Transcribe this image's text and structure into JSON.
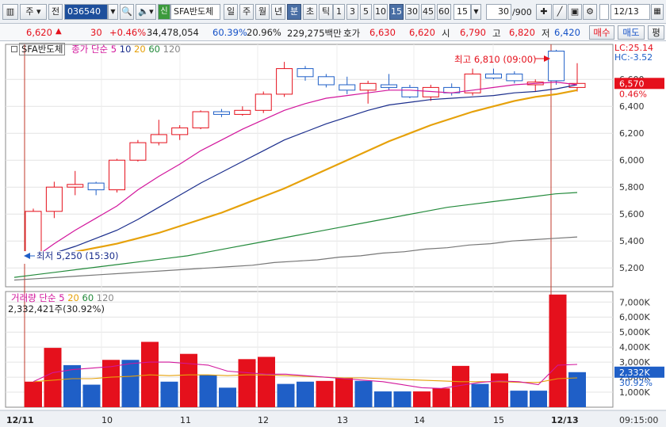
{
  "toolbar": {
    "type_label": "주",
    "market_label": "전",
    "code": "036540",
    "credit_badge": "신",
    "stock_name": "SFA반도체",
    "periods": [
      "일",
      "주",
      "월",
      "년",
      "분",
      "초",
      "틱"
    ],
    "active_period": "분",
    "intervals": [
      "1",
      "3",
      "5",
      "10",
      "15",
      "30",
      "45",
      "60"
    ],
    "active_interval": "15",
    "interval_select": "15",
    "count": "30",
    "count_max": "/900",
    "date": "12/13"
  },
  "quote": {
    "price": "6,620",
    "arrow": "▲",
    "change": "30",
    "change_pct": "+0.46%",
    "volume": "34,478,054",
    "vol_ratio": "60.39%",
    "turnover": "20.96%",
    "amount": "229,275백만",
    "hoga_label": "호가",
    "hoga_sell": "6,630",
    "hoga_buy": "6,620",
    "open_label": "시",
    "open": "6,790",
    "high_label": "고",
    "high": "6,820",
    "low_label": "저",
    "low": "6,420",
    "buy_btn": "매수",
    "sell_btn": "매도",
    "more_btn": "평"
  },
  "price_panel": {
    "name": "SFA반도체",
    "legend_prefix": "종가 단순",
    "ma_labels": [
      "5",
      "10",
      "20",
      "60",
      "120"
    ],
    "max_annotation": "최고 6,810 (09:00)",
    "min_annotation": "최저 5,250 (15:30)",
    "lc": "LC:25.14",
    "hc": "HC:-3.52",
    "current_price_tag": "6,570",
    "current_pct_tag": "0.46%"
  },
  "volume_panel": {
    "legend_prefix": "거래량 단순",
    "ma_labels": [
      "5",
      "20",
      "60",
      "120"
    ],
    "summary": "2,332,421주(30.92%)",
    "current_tag": "2,332K",
    "current_pct_tag": "30.92%"
  },
  "x_labels": [
    "12/11",
    "10",
    "11",
    "12",
    "13",
    "14",
    "15",
    "12/13"
  ],
  "time_label": "09:15:00",
  "colors": {
    "up": "#e5101c",
    "down": "#1f5fc7",
    "ma5": "#d2169c",
    "ma10": "#1a2d8c",
    "ma20": "#e6a10a",
    "ma60": "#238a3b",
    "ma120": "#777777"
  },
  "chart_data": {
    "type": "candlestick",
    "timeframe": "15min",
    "y_ticks": [
      5200,
      5400,
      5600,
      5800,
      6000,
      6200,
      6400,
      6600
    ],
    "candles": [
      {
        "o": 5260,
        "h": 5640,
        "l": 5250,
        "c": 5620
      },
      {
        "o": 5620,
        "h": 5840,
        "l": 5570,
        "c": 5800
      },
      {
        "o": 5800,
        "h": 5920,
        "l": 5740,
        "c": 5820
      },
      {
        "o": 5830,
        "h": 5840,
        "l": 5740,
        "c": 5780
      },
      {
        "o": 5780,
        "h": 6010,
        "l": 5760,
        "c": 6000
      },
      {
        "o": 6000,
        "h": 6150,
        "l": 5990,
        "c": 6130
      },
      {
        "o": 6130,
        "h": 6300,
        "l": 6110,
        "c": 6190
      },
      {
        "o": 6190,
        "h": 6260,
        "l": 6150,
        "c": 6240
      },
      {
        "o": 6240,
        "h": 6370,
        "l": 6230,
        "c": 6360
      },
      {
        "o": 6360,
        "h": 6380,
        "l": 6320,
        "c": 6340
      },
      {
        "o": 6340,
        "h": 6400,
        "l": 6330,
        "c": 6370
      },
      {
        "o": 6370,
        "h": 6510,
        "l": 6350,
        "c": 6490
      },
      {
        "o": 6490,
        "h": 6730,
        "l": 6470,
        "c": 6680
      },
      {
        "o": 6680,
        "h": 6700,
        "l": 6590,
        "c": 6620
      },
      {
        "o": 6620,
        "h": 6640,
        "l": 6540,
        "c": 6560
      },
      {
        "o": 6560,
        "h": 6620,
        "l": 6490,
        "c": 6520
      },
      {
        "o": 6520,
        "h": 6590,
        "l": 6420,
        "c": 6570
      },
      {
        "o": 6560,
        "h": 6640,
        "l": 6520,
        "c": 6540
      },
      {
        "o": 6540,
        "h": 6560,
        "l": 6460,
        "c": 6470
      },
      {
        "o": 6470,
        "h": 6560,
        "l": 6440,
        "c": 6540
      },
      {
        "o": 6540,
        "h": 6570,
        "l": 6480,
        "c": 6500
      },
      {
        "o": 6500,
        "h": 6680,
        "l": 6480,
        "c": 6640
      },
      {
        "o": 6640,
        "h": 6680,
        "l": 6600,
        "c": 6610
      },
      {
        "o": 6640,
        "h": 6660,
        "l": 6570,
        "c": 6590
      },
      {
        "o": 6560,
        "h": 6600,
        "l": 6510,
        "c": 6580
      },
      {
        "o": 6810,
        "h": 6820,
        "l": 6560,
        "c": 6590
      },
      {
        "o": 6540,
        "h": 6720,
        "l": 6510,
        "c": 6570
      }
    ],
    "ma": {
      "ma5": [
        5270,
        5380,
        5480,
        5570,
        5660,
        5780,
        5880,
        5970,
        6070,
        6150,
        6230,
        6300,
        6370,
        6420,
        6460,
        6480,
        6500,
        6520,
        6520,
        6510,
        6500,
        6520,
        6540,
        6560,
        6570,
        6580,
        6560
      ],
      "ma10": [
        5270,
        5310,
        5360,
        5420,
        5480,
        5560,
        5650,
        5740,
        5830,
        5910,
        5990,
        6070,
        6150,
        6210,
        6270,
        6320,
        6370,
        6410,
        6430,
        6450,
        6460,
        6470,
        6480,
        6500,
        6510,
        6530,
        6560
      ],
      "ma20": [
        5260,
        5290,
        5320,
        5350,
        5380,
        5420,
        5460,
        5510,
        5560,
        5610,
        5670,
        5730,
        5790,
        5860,
        5930,
        6000,
        6070,
        6140,
        6200,
        6260,
        6310,
        6360,
        6400,
        6440,
        6470,
        6490,
        6520
      ],
      "ma60": [
        5130,
        5150,
        5170,
        5190,
        5210,
        5230,
        5250,
        5270,
        5290,
        5320,
        5350,
        5380,
        5410,
        5440,
        5470,
        5500,
        5530,
        5560,
        5590,
        5620,
        5650,
        5670,
        5690,
        5710,
        5730,
        5750,
        5760
      ],
      "ma120": [
        5110,
        5120,
        5130,
        5140,
        5150,
        5160,
        5170,
        5180,
        5190,
        5200,
        5210,
        5220,
        5240,
        5250,
        5260,
        5280,
        5290,
        5310,
        5320,
        5340,
        5350,
        5370,
        5380,
        5400,
        5410,
        5420,
        5430
      ]
    },
    "volume_ticks": [
      "1,000K",
      "2,000K",
      "3,000K",
      "4,000K",
      "5,000K",
      "6,000K",
      "7,000K"
    ],
    "volume": [
      1700,
      3950,
      2800,
      1500,
      3150,
      3150,
      4350,
      1700,
      3550,
      2150,
      1300,
      3200,
      3350,
      1550,
      1700,
      1750,
      1950,
      1750,
      1050,
      1050,
      1050,
      1250,
      2750,
      1550,
      2250,
      1100,
      1100,
      7500,
      2332
    ],
    "volume_dir": [
      "up",
      "up",
      "down",
      "down",
      "up",
      "down",
      "up",
      "down",
      "up",
      "down",
      "down",
      "up",
      "up",
      "down",
      "down",
      "up",
      "up",
      "down",
      "down",
      "down",
      "up",
      "up",
      "up",
      "down",
      "up",
      "down",
      "down",
      "up",
      "down"
    ],
    "vol_ma5": [
      1700,
      2300,
      2500,
      2600,
      2700,
      2900,
      3000,
      3000,
      2900,
      2800,
      2400,
      2300,
      2200,
      2200,
      2100,
      2000,
      1900,
      1800,
      1700,
      1500,
      1300,
      1250,
      1450,
      1650,
      1750,
      1700,
      1500,
      2800,
      2850
    ],
    "vol_ma20": [
      1700,
      1800,
      1900,
      1900,
      2000,
      2050,
      2150,
      2100,
      2150,
      2150,
      2100,
      2150,
      2150,
      2100,
      2050,
      2000,
      1950,
      1950,
      1900,
      1850,
      1800,
      1750,
      1700,
      1700,
      1700,
      1650,
      1650,
      1900,
      1950
    ]
  }
}
